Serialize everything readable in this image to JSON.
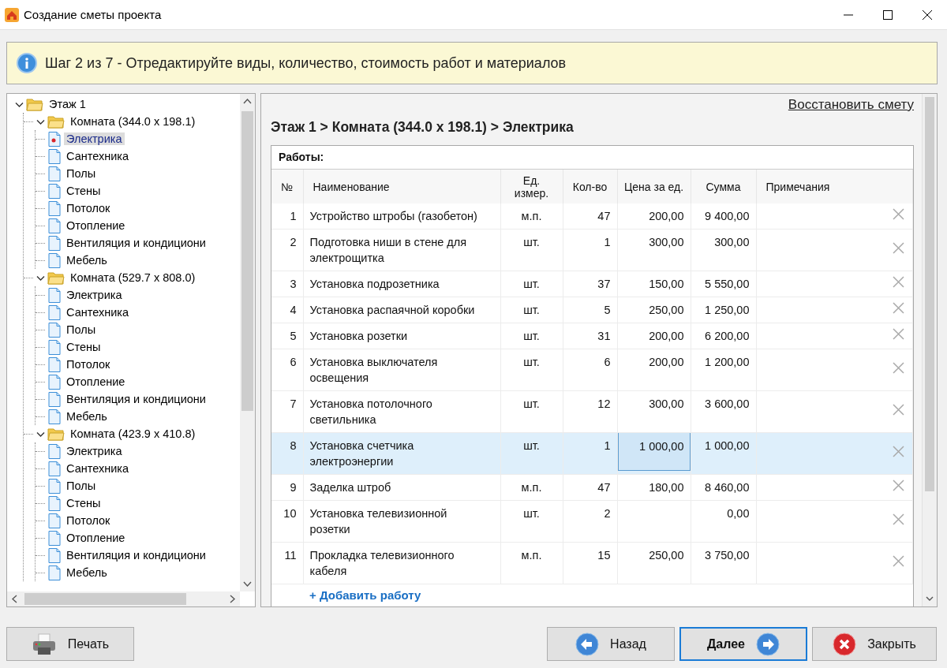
{
  "window": {
    "title": "Создание сметы проекта"
  },
  "banner": {
    "text": "Шаг 2 из 7 - Отредактируйте виды, количество, стоимость работ и материалов"
  },
  "tree": [
    {
      "label": "Этаж 1",
      "kind": "folder",
      "expanded": true,
      "selected": false,
      "children": [
        {
          "label": "Комната (344.0 x 198.1)",
          "kind": "folder",
          "expanded": true,
          "selected": false,
          "children": [
            {
              "label": "Электрика",
              "kind": "doc",
              "selected": true
            },
            {
              "label": "Сантехника",
              "kind": "doc",
              "selected": false
            },
            {
              "label": "Полы",
              "kind": "doc",
              "selected": false
            },
            {
              "label": "Стены",
              "kind": "doc",
              "selected": false
            },
            {
              "label": "Потолок",
              "kind": "doc",
              "selected": false
            },
            {
              "label": "Отопление",
              "kind": "doc",
              "selected": false
            },
            {
              "label": "Вентиляция и кондициони",
              "kind": "doc",
              "selected": false
            },
            {
              "label": "Мебель",
              "kind": "doc",
              "selected": false
            }
          ]
        },
        {
          "label": "Комната (529.7 x 808.0)",
          "kind": "folder",
          "expanded": true,
          "selected": false,
          "children": [
            {
              "label": "Электрика",
              "kind": "doc",
              "selected": false
            },
            {
              "label": "Сантехника",
              "kind": "doc",
              "selected": false
            },
            {
              "label": "Полы",
              "kind": "doc",
              "selected": false
            },
            {
              "label": "Стены",
              "kind": "doc",
              "selected": false
            },
            {
              "label": "Потолок",
              "kind": "doc",
              "selected": false
            },
            {
              "label": "Отопление",
              "kind": "doc",
              "selected": false
            },
            {
              "label": "Вентиляция и кондициони",
              "kind": "doc",
              "selected": false
            },
            {
              "label": "Мебель",
              "kind": "doc",
              "selected": false
            }
          ]
        },
        {
          "label": "Комната (423.9 x 410.8)",
          "kind": "folder",
          "expanded": true,
          "selected": false,
          "children": [
            {
              "label": "Электрика",
              "kind": "doc",
              "selected": false
            },
            {
              "label": "Сантехника",
              "kind": "doc",
              "selected": false
            },
            {
              "label": "Полы",
              "kind": "doc",
              "selected": false
            },
            {
              "label": "Стены",
              "kind": "doc",
              "selected": false
            },
            {
              "label": "Потолок",
              "kind": "doc",
              "selected": false
            },
            {
              "label": "Отопление",
              "kind": "doc",
              "selected": false
            },
            {
              "label": "Вентиляция и кондициони",
              "kind": "doc",
              "selected": false
            },
            {
              "label": "Мебель",
              "kind": "doc",
              "selected": false
            }
          ]
        }
      ]
    }
  ],
  "editor": {
    "restore_link": "Восстановить смету",
    "breadcrumb": "Этаж 1 > Комната (344.0 x 198.1) > Электрика",
    "section_title": "Работы:",
    "columns": [
      "№",
      "Наименование",
      "Ед. измер.",
      "Кол-во",
      "Цена за ед.",
      "Сумма",
      "Примечания"
    ],
    "rows": [
      {
        "num": "1",
        "name": "Устройство штробы (газобетон)",
        "unit": "м.п.",
        "qty": "47",
        "price": "200,00",
        "sum": "9 400,00",
        "selected": false
      },
      {
        "num": "2",
        "name": "Подготовка ниши в стене для электрощитка",
        "unit": "шт.",
        "qty": "1",
        "price": "300,00",
        "sum": "300,00",
        "selected": false
      },
      {
        "num": "3",
        "name": "Установка подрозетника",
        "unit": "шт.",
        "qty": "37",
        "price": "150,00",
        "sum": "5 550,00",
        "selected": false
      },
      {
        "num": "4",
        "name": "Установка распаячной коробки",
        "unit": "шт.",
        "qty": "5",
        "price": "250,00",
        "sum": "1 250,00",
        "selected": false
      },
      {
        "num": "5",
        "name": "Установка розетки",
        "unit": "шт.",
        "qty": "31",
        "price": "200,00",
        "sum": "6 200,00",
        "selected": false
      },
      {
        "num": "6",
        "name": "Установка выключателя освещения",
        "unit": "шт.",
        "qty": "6",
        "price": "200,00",
        "sum": "1 200,00",
        "selected": false
      },
      {
        "num": "7",
        "name": "Установка потолочного светильника",
        "unit": "шт.",
        "qty": "12",
        "price": "300,00",
        "sum": "3 600,00",
        "selected": false
      },
      {
        "num": "8",
        "name": "Установка счетчика электроэнергии",
        "unit": "шт.",
        "qty": "1",
        "price": "1 000,00",
        "sum": "1 000,00",
        "selected": true
      },
      {
        "num": "9",
        "name": "Заделка штроб",
        "unit": "м.п.",
        "qty": "47",
        "price": "180,00",
        "sum": "8 460,00",
        "selected": false
      },
      {
        "num": "10",
        "name": "Установка телевизионной розетки",
        "unit": "шт.",
        "qty": "2",
        "sum": "0,00",
        "selected": false
      },
      {
        "num": "11",
        "name": "Прокладка телевизионного кабеля",
        "unit": "м.п.",
        "qty": "15",
        "price": "250,00",
        "sum": "3 750,00",
        "selected": false
      }
    ],
    "add_link": "+ Добавить работу"
  },
  "buttons": [
    {
      "label": "Печать",
      "kind": "print",
      "default": false
    },
    {
      "label": "Назад",
      "kind": "back",
      "default": false
    },
    {
      "label": "Далее",
      "kind": "next",
      "default": true
    },
    {
      "label": "Закрыть",
      "kind": "close",
      "default": false
    }
  ]
}
